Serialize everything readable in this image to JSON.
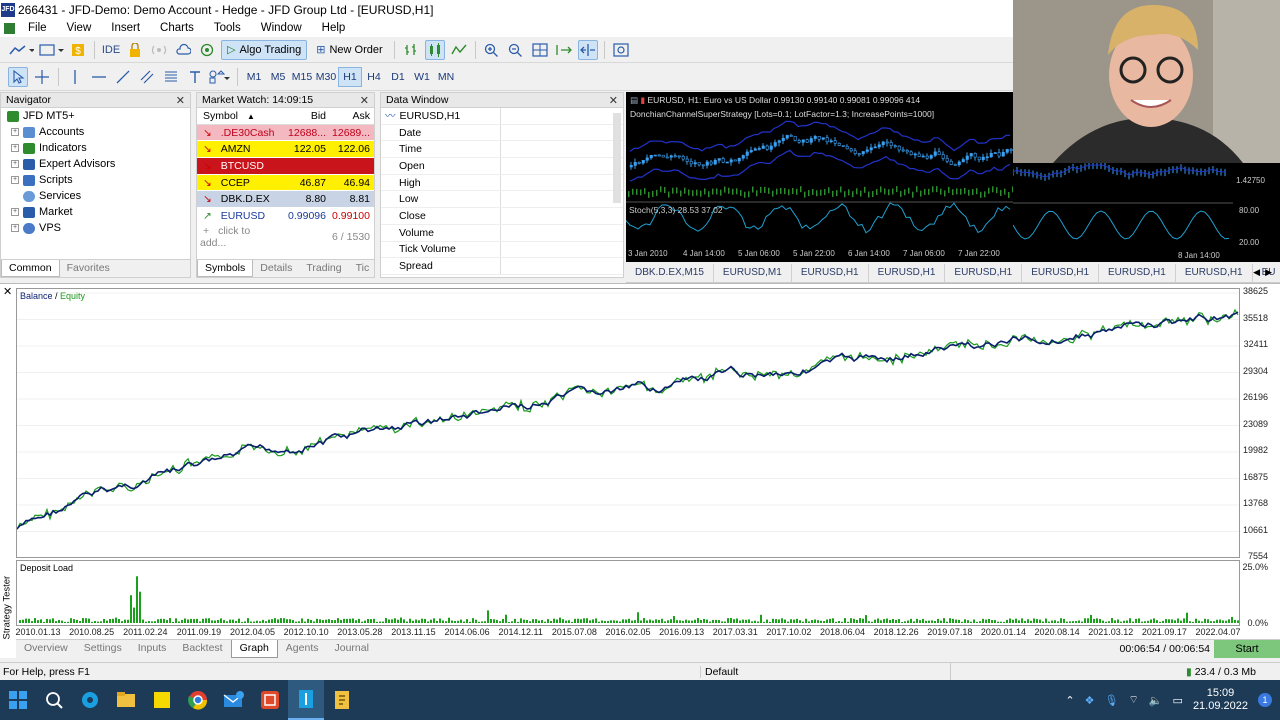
{
  "window": {
    "title": "266431 - JFD-Demo: Demo Account - Hedge - JFD Group Ltd - [EURUSD,H1]",
    "logo_text": "JFD"
  },
  "menu": [
    "File",
    "View",
    "Insert",
    "Charts",
    "Tools",
    "Window",
    "Help"
  ],
  "toolbar": {
    "ide_label": "IDE",
    "algo_label": "Algo Trading",
    "new_order_label": "New Order"
  },
  "timeframes": [
    "M1",
    "M5",
    "M15",
    "M30",
    "H1",
    "H4",
    "D1",
    "W1",
    "MN"
  ],
  "active_timeframe": "H1",
  "navigator": {
    "title": "Navigator",
    "root": "JFD MT5+",
    "items": [
      "Accounts",
      "Indicators",
      "Expert Advisors",
      "Scripts",
      "Services",
      "Market",
      "VPS"
    ],
    "tabs": [
      "Common",
      "Favorites"
    ]
  },
  "market_watch": {
    "title": "Market Watch: 14:09:15",
    "headers": [
      "Symbol",
      "Bid",
      "Ask"
    ],
    "rows": [
      {
        "symbol": ".DE30Cash",
        "bid": "12688...",
        "ask": "12689...",
        "bg": "#f4b8c0",
        "fg": "#c0001a"
      },
      {
        "symbol": "AMZN",
        "bid": "122.05",
        "ask": "122.06",
        "bg": "#ffef00",
        "fg": "#000000"
      },
      {
        "symbol": "BTCUSD",
        "bid": "",
        "ask": "",
        "bg": "#c8141a",
        "fg": "#ffffff"
      },
      {
        "symbol": "CCEP",
        "bid": "46.87",
        "ask": "46.94",
        "bg": "#ffef00",
        "fg": "#000000"
      },
      {
        "symbol": "DBK.D.EX",
        "bid": "8.80",
        "ask": "8.81",
        "bg": "#c8d4e6",
        "fg": "#000000"
      },
      {
        "symbol": "EURUSD",
        "bid": "0.99096",
        "ask": "0.99100",
        "bg": "#ffffff",
        "fg": "#1a3a9a"
      }
    ],
    "add_row": "click to add...",
    "count": "6 / 1530",
    "tabs": [
      "Symbols",
      "Details",
      "Trading",
      "Tic"
    ]
  },
  "data_window": {
    "title": "Data Window",
    "symbol": "EURUSD,H1",
    "fields": [
      "Date",
      "Time",
      "Open",
      "High",
      "Low",
      "Close",
      "Volume",
      "Tick Volume",
      "Spread"
    ]
  },
  "chart": {
    "header": "EURUSD, H1:  Euro vs US Dollar  0.99130 0.99140 0.99081 0.99096  414",
    "indicator": "DonchianChannelSuperStrategy [Lots=0.1; LotFactor=1.3; IncreasePoints=1000]",
    "stoch": "Stoch(5,3,3) 28.53 37.02",
    "time_labels": [
      "3 Jan 2010",
      "4 Jan 14:00",
      "5 Jan 06:00",
      "5 Jan 22:00",
      "6 Jan 14:00",
      "7 Jan 06:00",
      "7 Jan 22:00",
      "8 Jan 14:00"
    ],
    "right_labels": [
      "1.42750",
      "80.00",
      "20.00"
    ]
  },
  "chart_tabs": [
    "DBK.D.EX,M15",
    "EURUSD,M1",
    "EURUSD,H1",
    "EURUSD,H1",
    "EURUSD,H1",
    "EURUSD,H1",
    "EURUSD,H1",
    "EURUSD,H1",
    "EU"
  ],
  "tester": {
    "legend_balance": "Balance",
    "legend_sep": " / ",
    "legend_equity": "Equity",
    "y_labels": [
      "38625",
      "35518",
      "32411",
      "29304",
      "26196",
      "23089",
      "19982",
      "16875",
      "13768",
      "10661",
      "7554"
    ],
    "deposit_title": "Deposit Load",
    "deposit_labels": [
      "25.0%",
      "0.0%"
    ],
    "x_labels": [
      "2010.01.13",
      "2010.08.25",
      "2011.02.24",
      "2011.09.19",
      "2012.04.05",
      "2012.10.10",
      "2013.05.28",
      "2013.11.15",
      "2014.06.06",
      "2014.12.11",
      "2015.07.08",
      "2016.02.05",
      "2016.09.13",
      "2017.03.31",
      "2017.10.02",
      "2018.06.04",
      "2018.12.26",
      "2019.07.18",
      "2020.01.14",
      "2020.08.14",
      "2021.03.12",
      "2021.09.17",
      "2022.04.07"
    ],
    "tabs": [
      "Overview",
      "Settings",
      "Inputs",
      "Backtest",
      "Graph",
      "Agents",
      "Journal"
    ],
    "active_tab": "Graph",
    "time": "00:06:54 / 00:06:54",
    "start_label": "Start",
    "side_label": "Strategy Tester",
    "balance_color": "#0a1e6e",
    "equity_color": "#1a9a1a"
  },
  "status": {
    "help": "For Help, press F1",
    "profile": "Default",
    "traffic": "23.4 / 0.3 Mb"
  },
  "taskbar": {
    "time": "15:09",
    "date": "21.09.2022"
  }
}
